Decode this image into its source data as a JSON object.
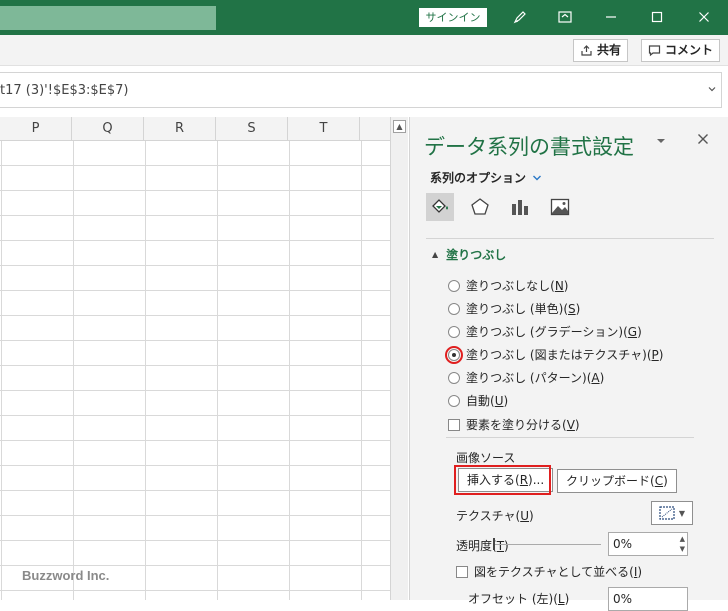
{
  "titlebar": {
    "signin_label": "サインイン"
  },
  "ribbon": {
    "share_label": "共有",
    "comment_label": "コメント"
  },
  "formula": {
    "text": "t17 (3)'!$E$3:$E$7)"
  },
  "grid": {
    "columns": [
      "P",
      "Q",
      "R",
      "S",
      "T"
    ]
  },
  "pane": {
    "title": "データ系列の書式設定",
    "series_options": "系列のオプション",
    "section_fill": "塗りつぶし",
    "fill_options": [
      {
        "label": "塗りつぶしなし",
        "key": "N"
      },
      {
        "label": "塗りつぶし (単色)",
        "key": "S"
      },
      {
        "label": "塗りつぶし (グラデーション)",
        "key": "G"
      },
      {
        "label": "塗りつぶし (図またはテクスチャ)",
        "key": "P"
      },
      {
        "label": "塗りつぶし (パターン)",
        "key": "A"
      },
      {
        "label": "自動",
        "key": "U"
      }
    ],
    "vary_colors": {
      "label": "要素を塗り分ける",
      "key": "V"
    },
    "image_source_label": "画像ソース",
    "insert_btn": {
      "label": "挿入する",
      "key": "R",
      "suffix": "..."
    },
    "clipboard_btn": {
      "label": "クリップボード",
      "key": "C"
    },
    "texture": {
      "label": "テクスチャ",
      "key": "U"
    },
    "transparency": {
      "label": "透明度",
      "key": "T",
      "value": "0%"
    },
    "tile": {
      "label": "図をテクスチャとして並べる",
      "key": "I"
    },
    "offset": {
      "label": "オフセット (左)",
      "key": "L",
      "value": "0%"
    }
  },
  "watermark": "Buzzword Inc."
}
